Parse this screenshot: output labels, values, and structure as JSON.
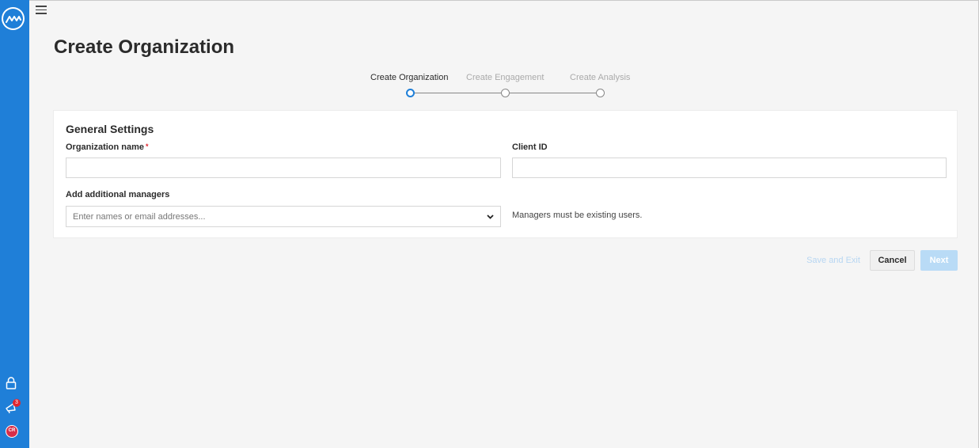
{
  "sidebar": {
    "badge_count": "3",
    "avatar_initials": "CR",
    "accent_color": "#1f7fd8"
  },
  "header": {
    "title": "Create Organization"
  },
  "stepper": {
    "steps": [
      {
        "label": "Create Organization",
        "state": "active"
      },
      {
        "label": "Create Engagement",
        "state": "inactive"
      },
      {
        "label": "Create Analysis",
        "state": "inactive"
      }
    ]
  },
  "form": {
    "section_title": "General Settings",
    "org_name_label": "Organization name",
    "org_name_required_mark": "*",
    "org_name_value": "",
    "client_id_label": "Client ID",
    "client_id_value": "",
    "managers_label": "Add additional managers",
    "managers_placeholder": "Enter names or email addresses...",
    "managers_helper": "Managers must be existing users."
  },
  "actions": {
    "save_exit_label": "Save and Exit",
    "cancel_label": "Cancel",
    "next_label": "Next"
  }
}
